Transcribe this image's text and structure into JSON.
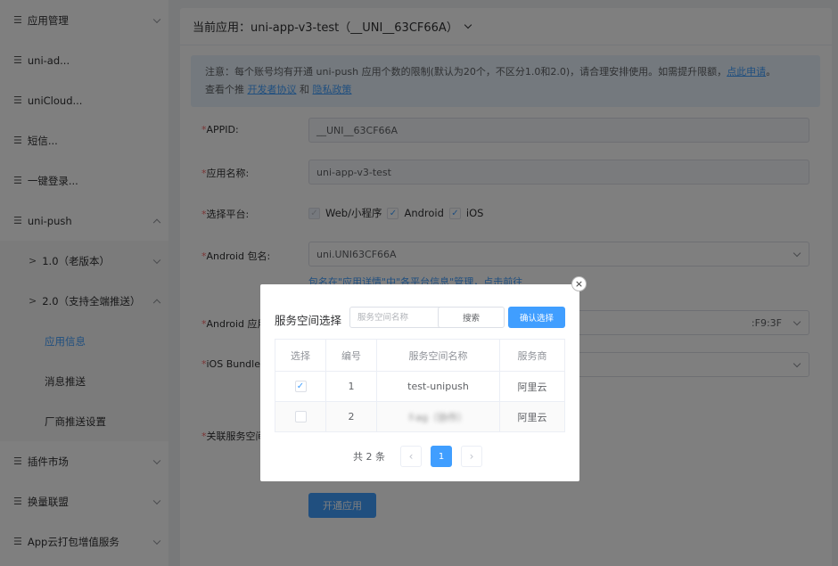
{
  "sidebar": {
    "items": [
      {
        "label": "应用管理",
        "expanded": false
      },
      {
        "label": "uni-ad...",
        "expanded": false
      },
      {
        "label": "uniCloud...",
        "expanded": false
      },
      {
        "label": "短信...",
        "expanded": false
      },
      {
        "label": "一键登录...",
        "expanded": false
      },
      {
        "label": "uni-push",
        "expanded": true
      }
    ],
    "push_sub": [
      {
        "label": "1.0（老版本）"
      },
      {
        "label": "2.0（支持全端推送）"
      }
    ],
    "push_leaves": [
      {
        "label": "应用信息",
        "active": true
      },
      {
        "label": "消息推送"
      },
      {
        "label": "厂商推送设置"
      }
    ],
    "bottom_items": [
      {
        "label": "插件市场"
      },
      {
        "label": "换量联盟"
      },
      {
        "label": "App云打包增值服务"
      }
    ]
  },
  "header": {
    "title": "当前应用：uni-app-v3-test（__UNI__63CF66A）"
  },
  "notice": {
    "line1": "注意：每个账号均有开通 uni-push 应用个数的限制(默认为20个，不区分1.0和2.0)，请合理安排使用。如需提升限额，",
    "apply_link": "点此申请",
    "line1_end": "。",
    "line2_prefix": "查看个推 ",
    "dev_agreement": "开发者协议",
    "and": " 和 ",
    "privacy": "隐私政策"
  },
  "form": {
    "required_mark": "*",
    "appid_label": "APPID:",
    "appid_value": "__UNI__63CF66A",
    "appname_label": "应用名称:",
    "appname_value": "uni-app-v3-test",
    "platform_label": "选择平台:",
    "platforms": [
      "Web/小程序",
      "Android",
      "iOS"
    ],
    "android_pkg_label": "Android 包名:",
    "android_pkg_value": "uni.UNI63CF66A",
    "pkg_hint": "包名在\"应用详情\"中\"各平台信息\"管理，点击前往",
    "android_sign_label": "Android 应用",
    "android_sign_value": ":F9:3F",
    "ios_bundle_label": "iOS Bundle",
    "linked_service_label": "关联服务空间",
    "submit": "开通应用"
  },
  "dialog": {
    "title": "服务空间选择",
    "search_placeholder": "服务空间名称",
    "search_button": "搜索",
    "confirm_button": "确认选择",
    "columns": [
      "选择",
      "编号",
      "服务空间名称",
      "服务商"
    ],
    "rows": [
      {
        "checked": true,
        "id": "1",
        "name": "test-unipush",
        "provider": "阿里云"
      },
      {
        "checked": false,
        "id": "2",
        "name": "f-ag（协作）",
        "provider": "阿里云"
      }
    ],
    "pagination": {
      "total_text": "共 2 条",
      "current_page": "1"
    },
    "close": "×"
  }
}
